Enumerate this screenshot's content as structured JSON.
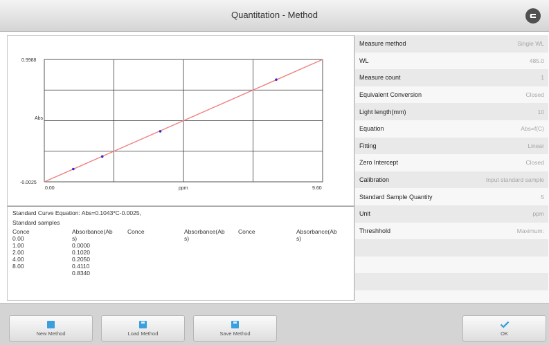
{
  "window": {
    "title": "Quantitation - Method"
  },
  "chart_data": {
    "type": "line",
    "xlabel": "ppm",
    "ylabel": "Abs",
    "xlim": [
      0.0,
      9.6
    ],
    "ylim": [
      -0.0025,
      0.9988
    ],
    "x_tick_labels": [
      "0.00",
      "9.60"
    ],
    "y_tick_labels": [
      "0.9988",
      "-0.0025"
    ],
    "grid": true,
    "series": [
      {
        "name": "fit",
        "kind": "line",
        "color": "#f08080",
        "x": [
          0.0,
          9.6
        ],
        "y": [
          -0.0025,
          0.9988
        ]
      },
      {
        "name": "points",
        "kind": "scatter",
        "color": "#2b2bd0",
        "x": [
          1.0,
          2.0,
          4.0,
          8.0
        ],
        "y": [
          0.102,
          0.205,
          0.411,
          0.834
        ]
      }
    ]
  },
  "result": {
    "equation": "Standard Curve Equation: Abs=0.1043*C-0.0025,",
    "standard_samples": "Standard samples",
    "col_conce": "Conce",
    "col_abs_line1": "Absorbance(Ab",
    "col_abs_line2": "s)",
    "conce_values": [
      "0.00",
      "1.00",
      "2.00",
      "4.00",
      "8.00"
    ],
    "abs_values": [
      "0.0000",
      "0.1020",
      "0.2050",
      "0.4110",
      "0.8340"
    ]
  },
  "params": [
    {
      "label": "Measure method",
      "value": "Single WL"
    },
    {
      "label": "WL",
      "value": "485.0"
    },
    {
      "label": "Measure count",
      "value": "1"
    },
    {
      "label": "Equivalent Conversion",
      "value": "Closed"
    },
    {
      "label": "Light length(mm)",
      "value": "10"
    },
    {
      "label": "Equation",
      "value": "Abs=f(C)"
    },
    {
      "label": "Fitting",
      "value": "Linear"
    },
    {
      "label": "Zero Intercept",
      "value": "Closed"
    },
    {
      "label": "Calibration",
      "value": "Input standard sample"
    },
    {
      "label": "Standard Sample Quantity",
      "value": "5"
    },
    {
      "label": "Unit",
      "value": "ppm"
    },
    {
      "label": "Threshhold",
      "value": "Maximum:"
    },
    {
      "label": "",
      "value": ""
    },
    {
      "label": "",
      "value": ""
    },
    {
      "label": "",
      "value": ""
    },
    {
      "label": "",
      "value": ""
    }
  ],
  "toolbar": {
    "new_method": "New Method",
    "load_method": "Load Method",
    "save_method": "Save Method",
    "ok": "OK"
  },
  "icons": {
    "back": "back-icon",
    "new": "new-file-icon",
    "load": "load-icon",
    "save": "save-icon",
    "ok": "checkmark-icon"
  }
}
